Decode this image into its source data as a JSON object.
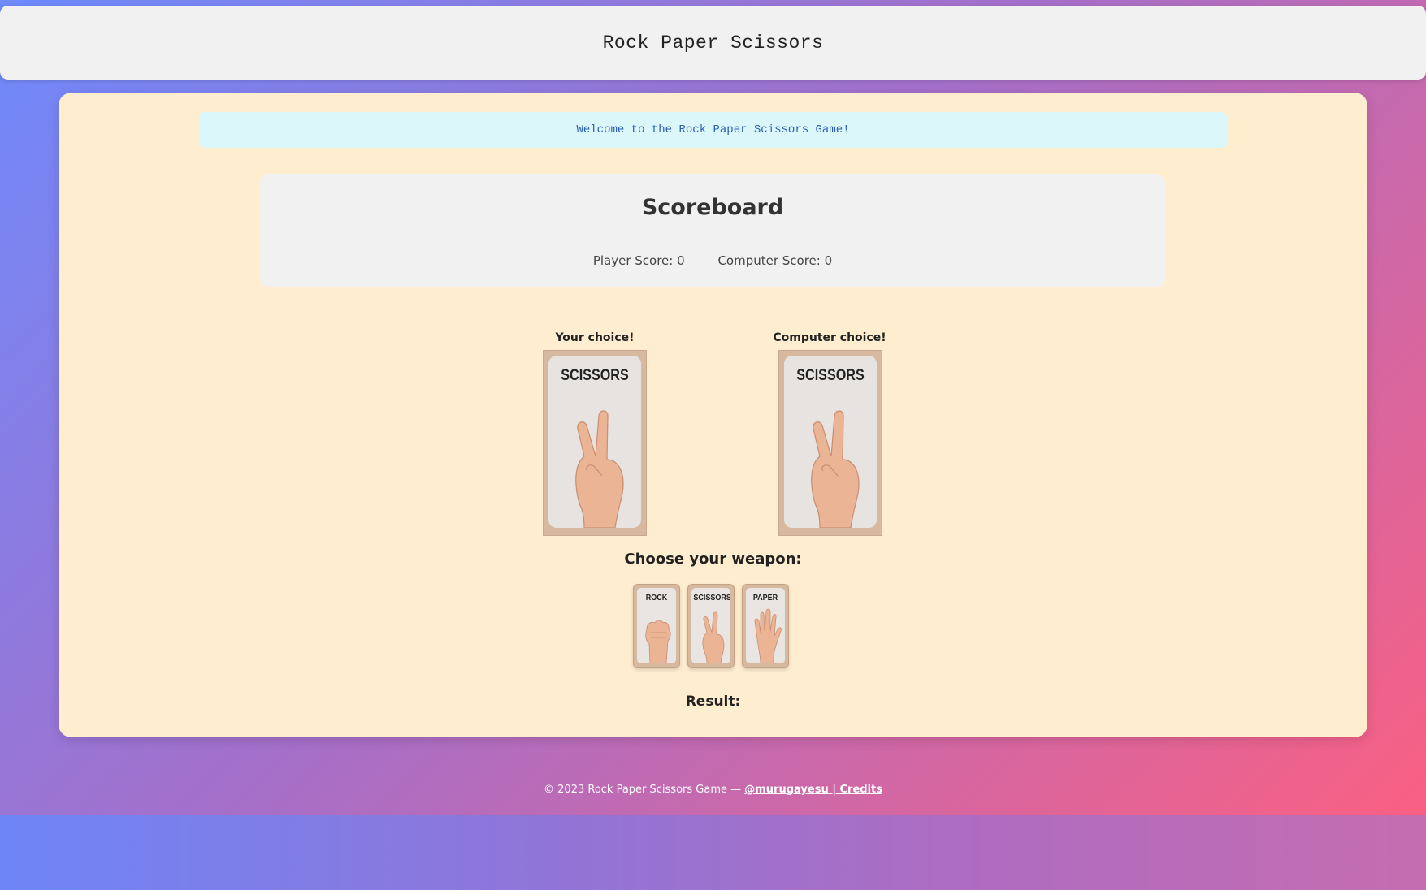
{
  "header": {
    "title": "Rock Paper Scissors"
  },
  "welcome": {
    "message": "Welcome to the Rock Paper Scissors Game!"
  },
  "scoreboard": {
    "title": "Scoreboard",
    "player_score": "Player Score: 0",
    "computer_score": "Computer Score: 0"
  },
  "choices": {
    "player_label": "Your choice!",
    "player_card": "SCISSORS",
    "computer_label": "Computer choice!",
    "computer_card": "SCISSORS"
  },
  "weapons": {
    "title": "Choose your weapon:",
    "options": [
      {
        "label": "ROCK",
        "icon": "fist-icon"
      },
      {
        "label": "SCISSORS",
        "icon": "peace-sign-icon"
      },
      {
        "label": "PAPER",
        "icon": "open-hand-icon"
      }
    ]
  },
  "result": {
    "label": "Result:"
  },
  "footer": {
    "copyright": "© 2023 Rock Paper Scissors Game — ",
    "author_link": "@murugayesu | ",
    "credits_link": "Credits"
  },
  "colors": {
    "card_background": "#ffedd0",
    "welcome_background": "#dcf7fa",
    "welcome_text": "#2a5fb3",
    "scoreboard_background": "#f1f1f1"
  }
}
